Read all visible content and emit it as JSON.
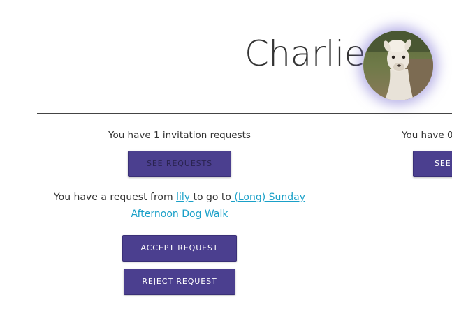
{
  "profile": {
    "name": "Charlie",
    "avatar_icon": "alpaca-photo"
  },
  "invitations": {
    "text": "You have 1 invitation requests",
    "see_button": "SEE REQUESTS"
  },
  "right_column": {
    "text": "You have 0",
    "see_button": "SEE"
  },
  "request": {
    "prefix": "You have a request from ",
    "user": "lily ",
    "middle": "to go to",
    "event": " (Long) Sunday Afternoon Dog Walk",
    "accept_button": "ACCEPT REQUEST",
    "reject_button": "REJECT REQUEST"
  },
  "colors": {
    "button": "#4b3f8f",
    "link": "#1aa0c8",
    "avatar_glow": "#786ed2"
  }
}
